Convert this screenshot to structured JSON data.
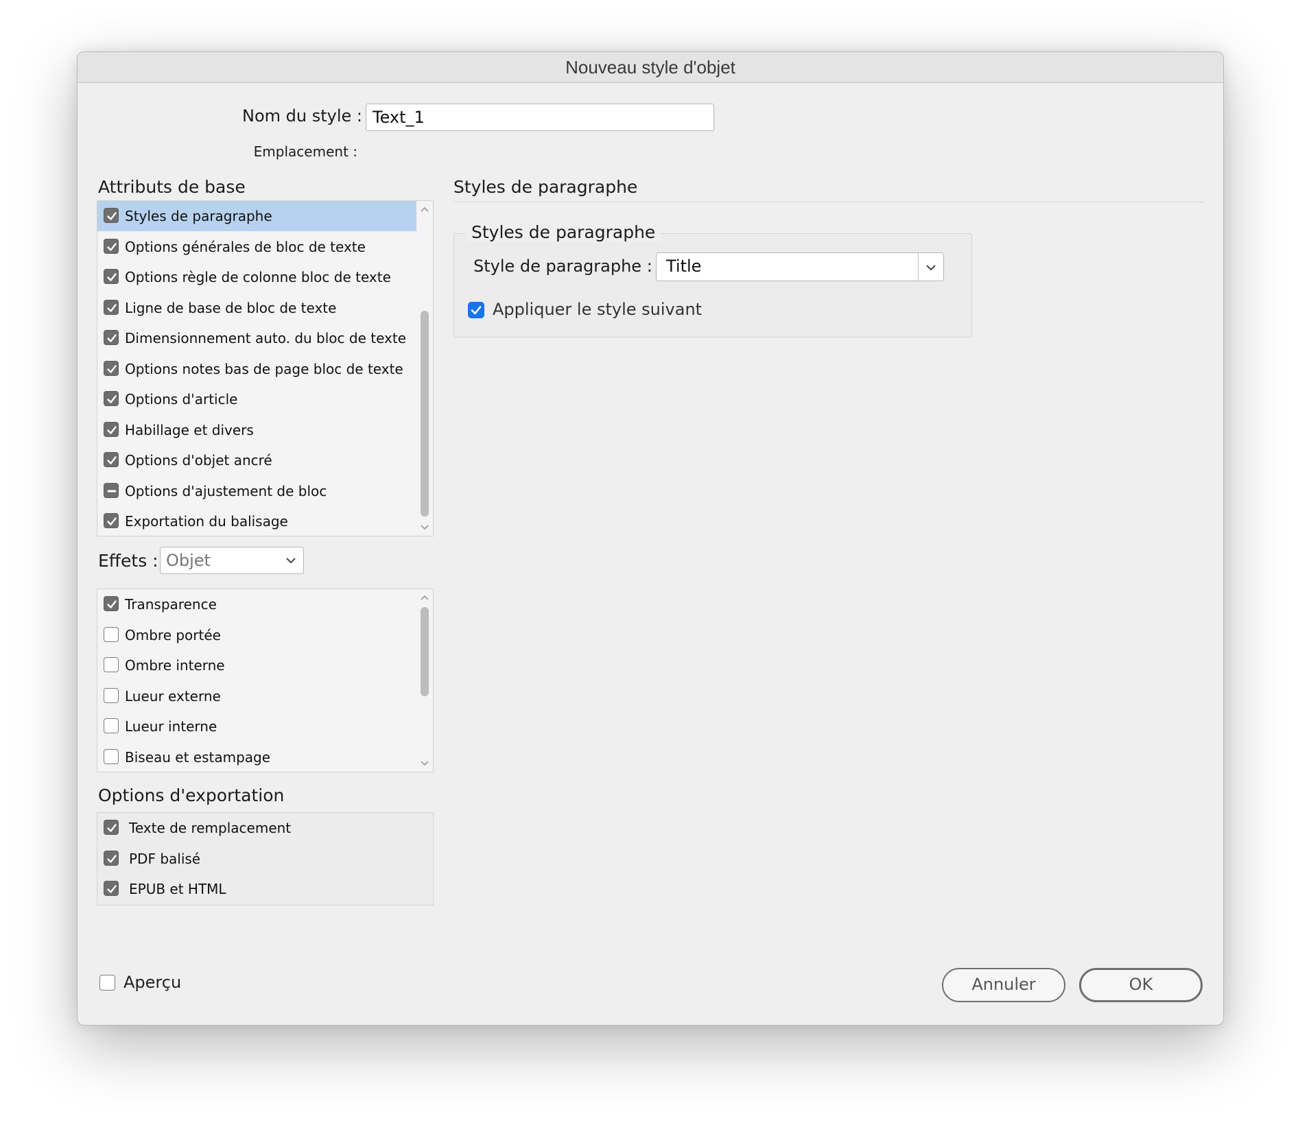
{
  "window": {
    "title": "Nouveau style d'objet"
  },
  "header": {
    "style_name_label": "Nom du style :",
    "style_name_value": "Text_1",
    "location_label": "Emplacement :"
  },
  "basic_attributes": {
    "title": "Attributs de base",
    "items": [
      {
        "label": "Styles de paragraphe",
        "state": "checked",
        "selected": true
      },
      {
        "label": "Options générales de bloc de texte",
        "state": "checked"
      },
      {
        "label": "Options règle de colonne bloc de texte",
        "state": "checked"
      },
      {
        "label": "Ligne de base de bloc de texte",
        "state": "checked"
      },
      {
        "label": "Dimensionnement auto. du bloc de texte",
        "state": "checked"
      },
      {
        "label": "Options notes bas de page bloc de texte",
        "state": "checked"
      },
      {
        "label": "Options d'article",
        "state": "checked"
      },
      {
        "label": "Habillage et divers",
        "state": "checked"
      },
      {
        "label": "Options d'objet ancré",
        "state": "checked"
      },
      {
        "label": "Options d'ajustement de bloc",
        "state": "mixed"
      },
      {
        "label": "Exportation du balisage",
        "state": "checked"
      }
    ]
  },
  "effects": {
    "label": "Effets :",
    "selected": "Objet",
    "items": [
      {
        "label": "Transparence",
        "state": "checked"
      },
      {
        "label": "Ombre portée",
        "state": "unchecked"
      },
      {
        "label": "Ombre interne",
        "state": "unchecked"
      },
      {
        "label": "Lueur externe",
        "state": "unchecked"
      },
      {
        "label": "Lueur interne",
        "state": "unchecked"
      },
      {
        "label": "Biseau et estampage",
        "state": "unchecked"
      }
    ]
  },
  "export_options": {
    "title": "Options d'exportation",
    "items": [
      {
        "label": "Texte de remplacement",
        "state": "checked"
      },
      {
        "label": "PDF balisé",
        "state": "checked"
      },
      {
        "label": "EPUB et HTML",
        "state": "checked"
      }
    ]
  },
  "panel": {
    "title": "Styles de paragraphe",
    "group_title": "Styles de paragraphe",
    "paragraph_style_label": "Style de paragraphe :",
    "paragraph_style_value": "Title",
    "apply_next_label": "Appliquer le style suivant",
    "apply_next_checked": true
  },
  "footer": {
    "preview_label": "Aperçu",
    "preview_checked": false,
    "cancel_label": "Annuler",
    "ok_label": "OK"
  },
  "colors": {
    "selection": "#b7d2ef",
    "accent_blue": "#1a73e8",
    "checkbox_gray": "#6e6e6e"
  }
}
